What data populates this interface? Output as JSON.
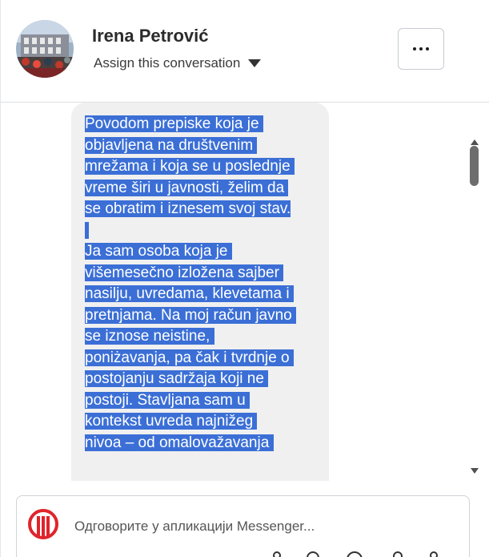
{
  "header": {
    "contact_name": "Irena Petrović",
    "assign_label": "Assign this conversation",
    "more_label": "More options"
  },
  "thread": {
    "message_lines": [
      "Povodom prepiske koja je ",
      "objavljena na društvenim ",
      "mrežama i koja se u poslednje ",
      "vreme širi u javnosti, želim da ",
      "se obratim i iznesem svoj stav.",
      " ",
      "Ja sam osoba koja je ",
      "višemesečno izložena sajber ",
      "nasilju, uvredama, klevetama i ",
      "pretnjama. Na moj račun javno ",
      "se iznose neistine, ",
      "poniżavanja, pa čak i tvrdnje o ",
      "postojanju sadržaja koji ne ",
      "postoji. Stavljana sam u ",
      "kontekst uvreda najnižeg ",
      "nivoa – od omalovažavanja "
    ],
    "selection_color": "#3b6fd6",
    "bubble_color": "#f0f0f0"
  },
  "reply": {
    "text": "Одговорите у апликацији Messenger...",
    "logo_color": "#e0242b"
  }
}
